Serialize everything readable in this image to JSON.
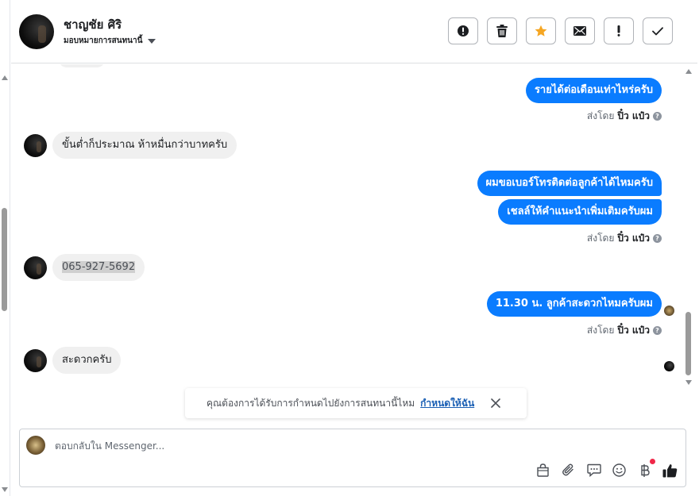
{
  "header": {
    "contact_name": "ชาญชัย ศิริ",
    "assign_label": "มอบหมายการสนทนานี้",
    "actions": [
      {
        "name": "spam-button",
        "icon": "alert-circle-icon"
      },
      {
        "name": "delete-button",
        "icon": "trash-icon"
      },
      {
        "name": "star-button",
        "icon": "star-icon",
        "color": "#f5a623"
      },
      {
        "name": "mark-unread-button",
        "icon": "envelope-icon"
      },
      {
        "name": "follow-up-button",
        "icon": "exclamation-icon"
      },
      {
        "name": "mark-done-button",
        "icon": "check-icon"
      }
    ]
  },
  "messages": {
    "m1_out": "รายได้ต่อเดือนเท่าไหร่ครับ",
    "m1_sent_by_label": "ส่งโดย",
    "m1_sent_by_name": "ปิ๋ว แป๋ว",
    "m2_in": "ขั้นต่ำก็ประมาณ  ห้าหมื่นกว่าบาทครับ",
    "m3_out": "ผมขอเบอร์โทรติดต่อลูกค้าได้ไหมครับ",
    "m4_out": "เชลล์ให้คำแนะนำเพิ่มเติมครับผม",
    "m4_sent_by_label": "ส่งโดย",
    "m4_sent_by_name": "ปิ๋ว แป๋ว",
    "m5_in": "065-927-5692",
    "m6_out": "11.30 น. ลูกค้าสะดวกไหมครับผม",
    "m6_sent_by_label": "ส่งโดย",
    "m6_sent_by_name": "ปิ๋ว แป๋ว",
    "m7_in": "สะดวกครับ"
  },
  "notice": {
    "text": "คุณต้องการได้รับการกำหนดไปยังการสนทนานี้ไหม",
    "link": "กำหนดให้ฉัน"
  },
  "composer": {
    "placeholder": "ตอบกลับใน Messenger..."
  },
  "colors": {
    "outgoing_bubble": "#0a7cff",
    "incoming_bubble": "#f0f0f0",
    "star": "#f5a623",
    "notification_dot": "#f02849"
  }
}
